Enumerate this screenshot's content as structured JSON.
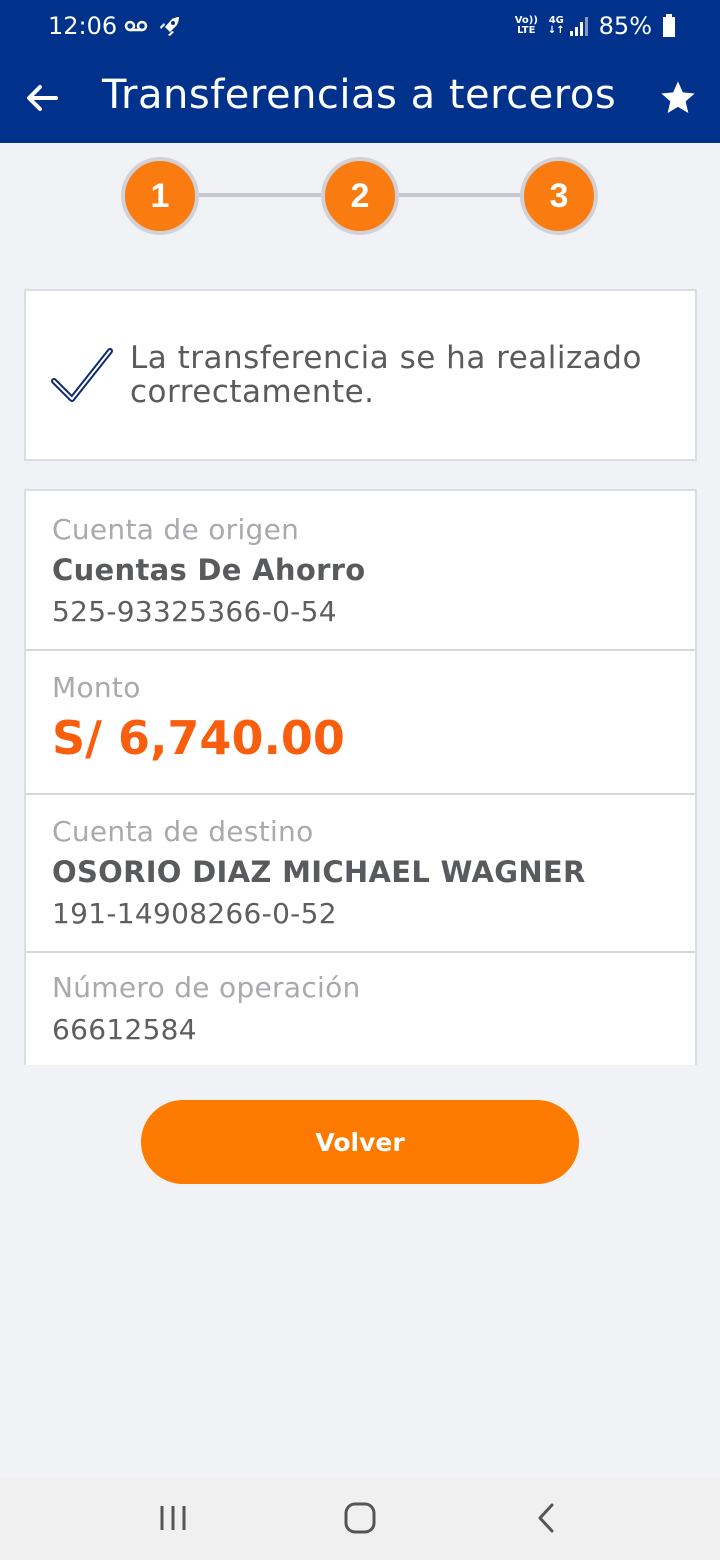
{
  "status_bar": {
    "time": "12:06",
    "network_top": "Vo))",
    "network_bottom": "LTE",
    "signal_type": "4G",
    "battery": "85%",
    "icons": [
      "voicemail-icon",
      "rocket-icon",
      "signal-icon",
      "battery-icon"
    ]
  },
  "app_bar": {
    "title": "Transferencias a terceros",
    "back_icon": "arrow-left-icon",
    "favorite_icon": "star-icon",
    "color": "#00328c"
  },
  "stepper": {
    "steps": [
      "1",
      "2",
      "3"
    ],
    "accent": "#fa7b10"
  },
  "success": {
    "icon": "checkmark-icon",
    "message": "La transferencia se ha realizado correctamente."
  },
  "details": {
    "origin": {
      "label": "Cuenta de origen",
      "account_type": "Cuentas De Ahorro",
      "account_number": "525-93325366-0-54"
    },
    "amount": {
      "label": "Monto",
      "value": "S/ 6,740.00",
      "color": "#f85e0e"
    },
    "destination": {
      "label": "Cuenta de destino",
      "name": "OSORIO DIAZ MICHAEL WAGNER",
      "account_number": "191-14908266-0-52"
    },
    "operation": {
      "label": "Número de operación",
      "number": "66612584"
    }
  },
  "actions": {
    "volver_label": "Volver",
    "button_color": "#fd7a00"
  },
  "nav_bar": {
    "icons": [
      "recent-apps-icon",
      "home-icon",
      "back-icon"
    ]
  }
}
